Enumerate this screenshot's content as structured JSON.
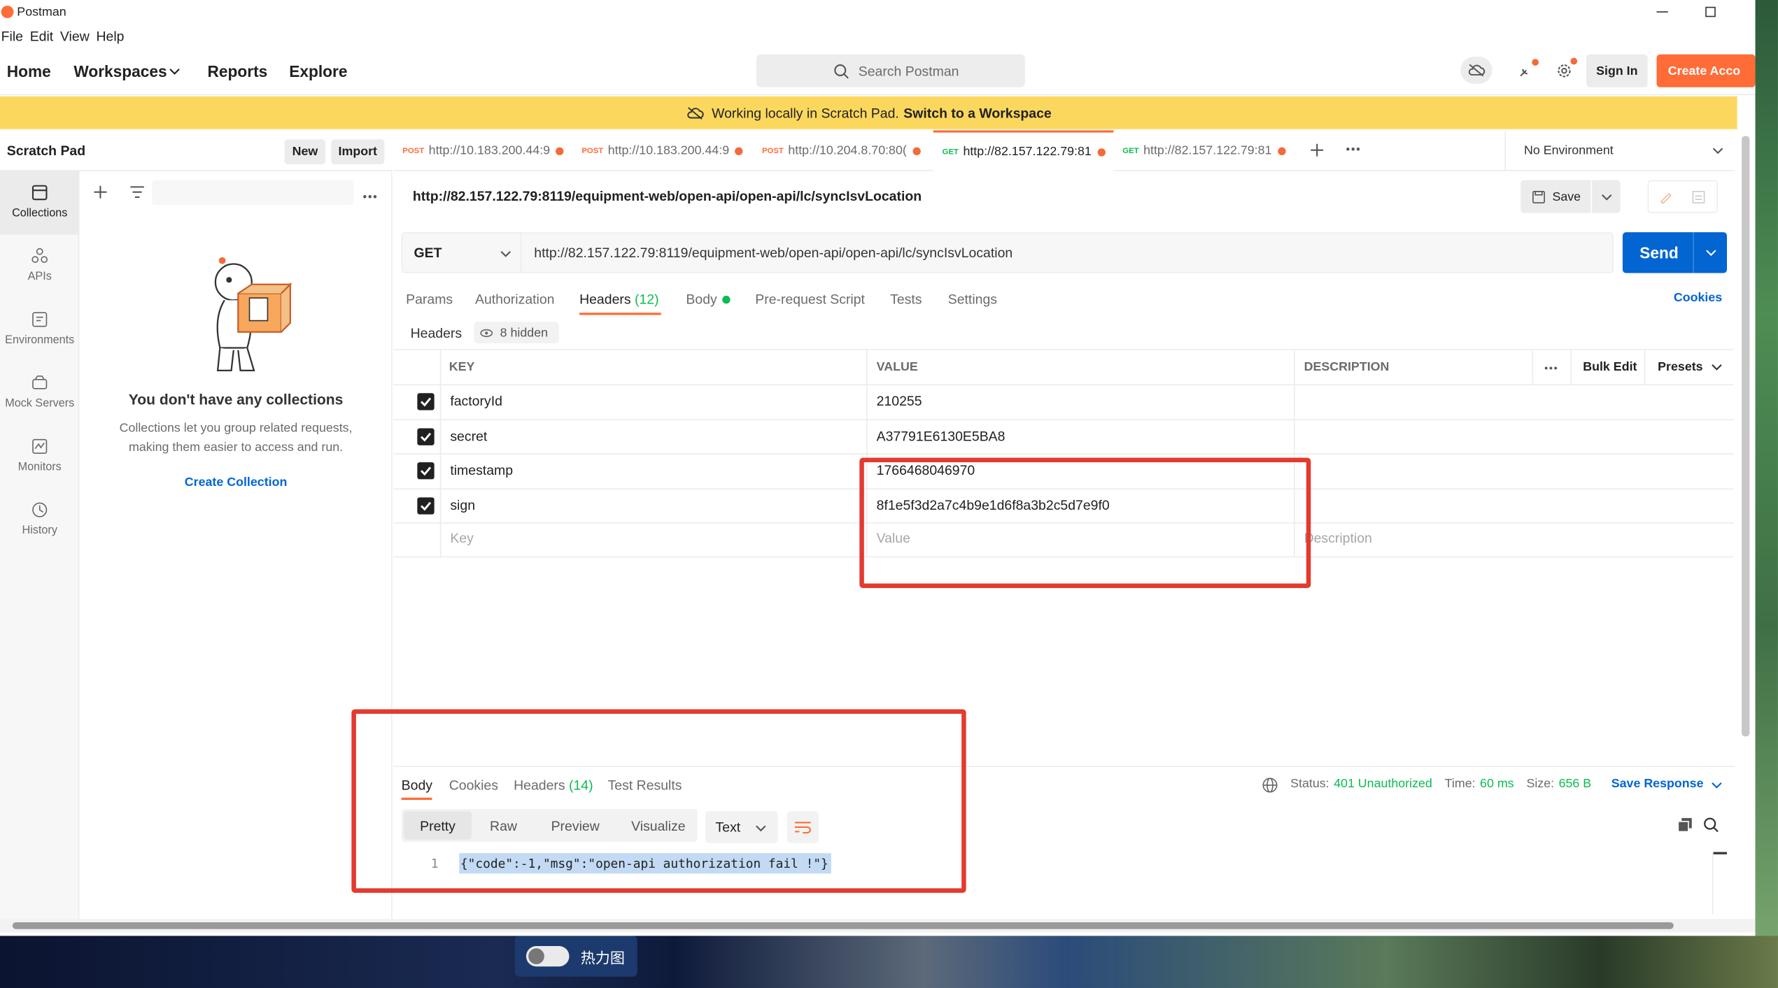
{
  "app": {
    "title": "Postman"
  },
  "menu": [
    "File",
    "Edit",
    "View",
    "Help"
  ],
  "header": {
    "nav": [
      "Home",
      "Workspaces",
      "Reports",
      "Explore"
    ],
    "search_placeholder": "Search Postman",
    "sign_in": "Sign In",
    "create_account": "Create Acco"
  },
  "banner": {
    "text": "Working locally in Scratch Pad.",
    "link": "Switch to a Workspace"
  },
  "sidebar": {
    "title": "Scratch Pad",
    "new": "New",
    "import": "Import",
    "rail": [
      {
        "label": "Collections",
        "icon": "collections-icon"
      },
      {
        "label": "APIs",
        "icon": "apis-icon"
      },
      {
        "label": "Environments",
        "icon": "environments-icon"
      },
      {
        "label": "Mock Servers",
        "icon": "mock-servers-icon"
      },
      {
        "label": "Monitors",
        "icon": "monitors-icon"
      },
      {
        "label": "History",
        "icon": "history-icon"
      }
    ],
    "empty_title": "You don't have any collections",
    "empty_text_1": "Collections let you group related requests,",
    "empty_text_2": "making them easier to access and run.",
    "create_collection": "Create Collection"
  },
  "tabs": [
    {
      "method": "POST",
      "url": "http://10.183.200.44:9"
    },
    {
      "method": "POST",
      "url": "http://10.183.200.44:9"
    },
    {
      "method": "POST",
      "url": "http://10.204.8.70:80("
    },
    {
      "method": "GET",
      "url": "http://82.157.122.79:81"
    },
    {
      "method": "GET",
      "url": "http://82.157.122.79:81"
    }
  ],
  "environment": "No Environment",
  "request": {
    "name": "http://82.157.122.79:8119/equipment-web/open-api/open-api/lc/syncIsvLocation",
    "save": "Save",
    "method": "GET",
    "url": "http://82.157.122.79:8119/equipment-web/open-api/open-api/lc/syncIsvLocation",
    "send": "Send",
    "subtabs": [
      "Params",
      "Authorization",
      "Headers",
      "Body",
      "Pre-request Script",
      "Tests",
      "Settings"
    ],
    "headers_count": "(12)",
    "cookies": "Cookies",
    "headers_label": "Headers",
    "hidden": "8 hidden",
    "columns": {
      "key": "KEY",
      "value": "VALUE",
      "description": "DESCRIPTION",
      "bulk_edit": "Bulk Edit",
      "presets": "Presets"
    },
    "rows": [
      {
        "key": "factoryId",
        "value": "210255"
      },
      {
        "key": "secret",
        "value": "A37791E6130E5BA8"
      },
      {
        "key": "timestamp",
        "value": "1766468046970"
      },
      {
        "key": "sign",
        "value": "8f1e5f3d2a7c4b9e1d6f8a3b2c5d7e9f0"
      }
    ],
    "placeholders": {
      "key": "Key",
      "value": "Value",
      "description": "Description"
    }
  },
  "response": {
    "tabs": [
      "Body",
      "Cookies",
      "Headers",
      "Test Results"
    ],
    "headers_count": "(14)",
    "status_label": "Status:",
    "status": "401 Unauthorized",
    "time_label": "Time:",
    "time": "60 ms",
    "size_label": "Size:",
    "size": "656 B",
    "save_response": "Save Response",
    "views": [
      "Pretty",
      "Raw",
      "Preview",
      "Visualize"
    ],
    "format": "Text",
    "line_no": "1",
    "body": "{\"code\":-1,\"msg\":\"open-api authorization fail !\"}"
  },
  "taskbar": {
    "toggle_label": "热力图"
  },
  "colors": {
    "accent": "#ff6c37",
    "send": "#0265d2",
    "banner": "#fbd85d",
    "status_ok": "#0cbb52",
    "highlight": "#e33a2f"
  }
}
